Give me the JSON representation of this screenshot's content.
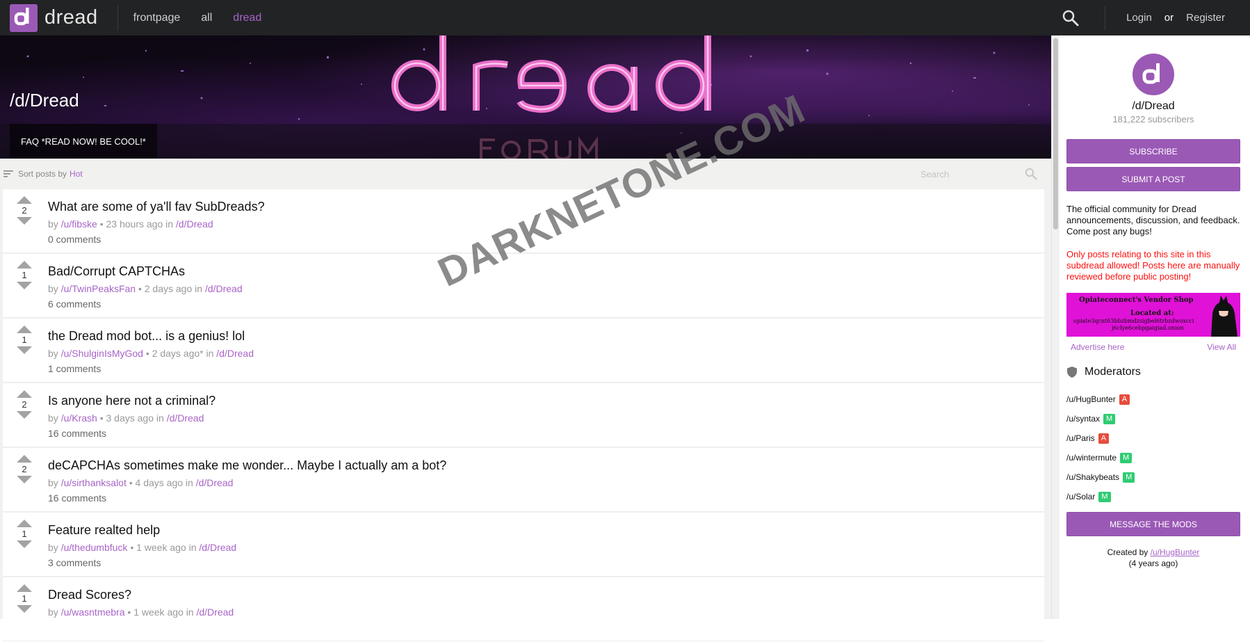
{
  "topbar": {
    "brand": "dread",
    "logo_letter": "d",
    "nav": [
      {
        "label": "frontpage",
        "active": false
      },
      {
        "label": "all",
        "active": false
      },
      {
        "label": "dread",
        "active": true
      }
    ],
    "login": "Login",
    "or": "or",
    "register": "Register"
  },
  "banner": {
    "title": "/d/Dread",
    "tab": "FAQ *READ NOW! BE COOL!*"
  },
  "sortbar": {
    "label": "Sort posts by",
    "value": "Hot",
    "search_placeholder": "Search"
  },
  "posts": [
    {
      "score": "2",
      "title": "What are some of ya'll fav SubDreads?",
      "by": "by",
      "author": "/u/fibske",
      "time": "• 23 hours ago in",
      "sub": "/d/Dread",
      "comments": "0 comments"
    },
    {
      "score": "1",
      "title": "Bad/Corrupt CAPTCHAs",
      "by": "by",
      "author": "/u/TwinPeaksFan",
      "time": "• 2 days ago in",
      "sub": "/d/Dread",
      "comments": "6 comments"
    },
    {
      "score": "1",
      "title": "the Dread mod bot... is a genius! lol",
      "by": "by",
      "author": "/u/ShulginIsMyGod",
      "time": "• 2 days ago* in",
      "sub": "/d/Dread",
      "comments": "1 comments"
    },
    {
      "score": "2",
      "title": "Is anyone here not a criminal?",
      "by": "by",
      "author": "/u/Krash",
      "time": "• 3 days ago in",
      "sub": "/d/Dread",
      "comments": "16 comments"
    },
    {
      "score": "2",
      "title": "deCAPCHAs sometimes make me wonder... Maybe I actually am a bot?",
      "by": "by",
      "author": "/u/sirthanksalot",
      "time": "• 4 days ago in",
      "sub": "/d/Dread",
      "comments": "16 comments"
    },
    {
      "score": "1",
      "title": "Feature realted help",
      "by": "by",
      "author": "/u/thedumbfuck",
      "time": "• 1 week ago in",
      "sub": "/d/Dread",
      "comments": "3 comments"
    },
    {
      "score": "1",
      "title": "Dread Scores?",
      "by": "by",
      "author": "/u/wasntmebra",
      "time": "• 1 week ago in",
      "sub": "/d/Dread",
      "comments": ""
    }
  ],
  "watermark": "DARKNETONE.COM",
  "sidebar": {
    "name": "/d/Dread",
    "subscribers": "181,222 subscribers",
    "subscribe": "SUBSCRIBE",
    "submit": "SUBMIT A POST",
    "description": "The official community for Dread announcements, discussion, and feedback. Come post any bugs!",
    "warning": "Only posts relating to this site in this subdread allowed! Posts here are manually reviewed before public posting!",
    "ad": {
      "line1": "Opiateconnect's Vendor Shop",
      "line2": "Located at:",
      "line3": "opiate3qcnt63bbzbmdzsigbel6trbzdwoxcci",
      "line4": "j6clye6cebpgaigiad.onion",
      "advertise": "Advertise here",
      "view_all": "View All"
    },
    "moderators_title": "Moderators",
    "moderators": [
      {
        "name": "/u/HugBunter",
        "badge": "A"
      },
      {
        "name": "/u/syntax",
        "badge": "M"
      },
      {
        "name": "/u/Paris",
        "badge": "A"
      },
      {
        "name": "/u/wintermute",
        "badge": "M"
      },
      {
        "name": "/u/Shakybeats",
        "badge": "M"
      },
      {
        "name": "/u/Solar",
        "badge": "M"
      }
    ],
    "message_mods": "MESSAGE THE MODS",
    "created_by": "Created by",
    "creator": "/u/HugBunter",
    "created_ago": "(4 years ago)"
  },
  "colors": {
    "accent": "#9b59b6",
    "link": "#a864c8",
    "topbar": "#222325",
    "warning": "#ff1010",
    "badge_admin": "#e74c3c",
    "badge_mod": "#2ecc71"
  }
}
